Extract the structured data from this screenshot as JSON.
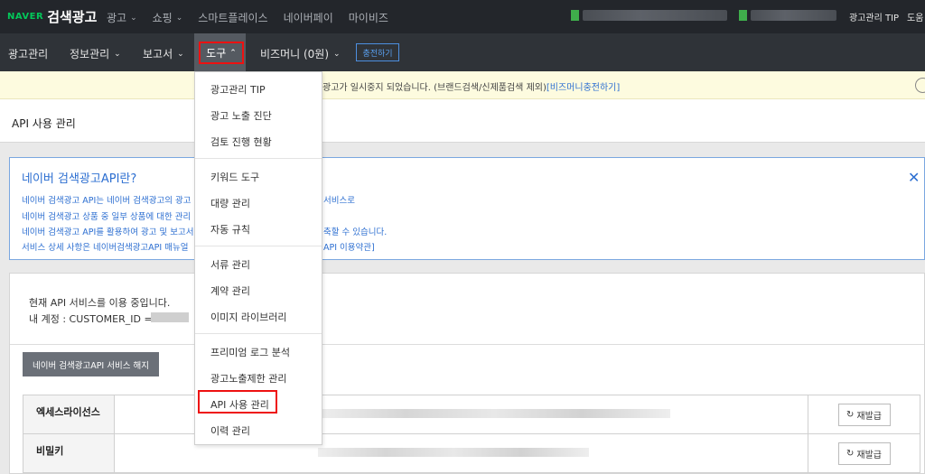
{
  "topbar": {
    "logo_naver": "NAVER",
    "logo_text": "검색광고",
    "nav": [
      {
        "label": "광고",
        "has_chevron": true
      },
      {
        "label": "쇼핑",
        "has_chevron": true
      },
      {
        "label": "스마트플레이스",
        "has_chevron": false
      },
      {
        "label": "네이버페이",
        "has_chevron": false
      },
      {
        "label": "마이비즈",
        "has_chevron": false
      }
    ],
    "tip": "광고관리 TIP",
    "help": "도움"
  },
  "subnav": {
    "items": [
      "광고관리",
      "정보관리",
      "보고서",
      "도구",
      "비즈머니 (0원)"
    ],
    "charge_button": "충전하기"
  },
  "notice": {
    "text": "광고가 일시중지 되었습니다. (브랜드검색/신제품검색 제외)",
    "link": "[비즈머니충전하기]"
  },
  "page": {
    "title": "API 사용 관리"
  },
  "info": {
    "title": "네이버 검색광고API란?",
    "lines": [
      "네이버 검색광고 API는 네이버 검색광고의 광고",
      "네이버 검색광고 상품 중 일부 상품에 대한 관리",
      "네이버 검색광고 API를 활용하여 광고 및 보고서",
      "서비스 상세 사항은 네이버검색광고API 매뉴얼"
    ],
    "lines_tail": [
      "서비스로",
      "",
      "축할 수 있습니다.",
      "API 이용약관]"
    ]
  },
  "main": {
    "status": "현재 API 서비스를 이용 중입니다.",
    "account_label": "내 계정 : CUSTOMER_ID =",
    "cancel_button": "네이버 검색광고API 서비스 해지",
    "rows": [
      {
        "header": "엑세스라이선스",
        "action": "재발급"
      },
      {
        "header": "비밀키",
        "action": "재발급"
      }
    ]
  },
  "dropdown": {
    "items": [
      "광고관리 TIP",
      "광고 노출 진단",
      "검토 진행 현황",
      "키워드 도구",
      "대량 관리",
      "자동 규칙",
      "서류 관리",
      "계약 관리",
      "이미지 라이브러리",
      "프리미엄 로그 분석",
      "광고노출제한 관리",
      "API 사용 관리",
      "이력 관리"
    ],
    "highlighted": "API 사용 관리"
  },
  "colors": {
    "topbar_bg": "#23262b",
    "subnav_bg": "#2f3338",
    "link_blue": "#2d6fd1",
    "naver_green": "#03c75a",
    "highlight_red": "#ee1111"
  }
}
